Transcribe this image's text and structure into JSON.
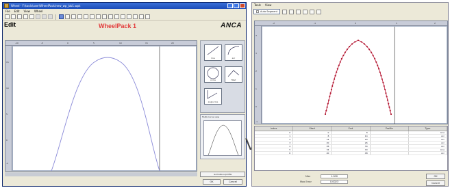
{
  "left_window": {
    "title": "Wheel - F:\\tools\\user\\WheelPack\\new_wp_job1.wpk",
    "menu": [
      "File",
      "Edit",
      "View",
      "Wheel"
    ],
    "edit_label": "Edit",
    "wheel_title": "WheelPack 1",
    "logo": "ANCA",
    "ruler_top_labels": [
      "-10",
      "-5",
      "0",
      "5",
      "10",
      "15",
      "20"
    ],
    "ruler_left_labels": [
      "15",
      "10",
      "5",
      "0",
      "-5"
    ],
    "shapes": [
      {
        "label": "line",
        "icon": "line-shape-icon"
      },
      {
        "label": "arc",
        "icon": "arc-shape-icon"
      },
      {
        "label": "circle",
        "icon": "circle-shape-icon"
      },
      {
        "label": "fillet",
        "icon": "fillet-shape-icon"
      },
      {
        "label": "angle line",
        "icon": "angle-line-shape-icon"
      }
    ],
    "preview_label": "Multi-Curve view",
    "profile_button": "re-locate a profile",
    "ok": "OK",
    "cancel": "Cancel"
  },
  "right_window": {
    "menu": [
      "Tools",
      "View"
    ],
    "auto_segment": "Auto Segment",
    "ruler_top_labels": [
      "-2",
      "-1",
      "0",
      "1",
      "2"
    ],
    "ruler_left_labels": [
      "4",
      "3",
      "2",
      "1",
      "0",
      "-1"
    ],
    "table": {
      "columns": [
        "Index",
        "Start",
        "End",
        "Profile",
        "Type"
      ],
      "rows": [
        [
          "0",
          "0",
          "8",
          "",
          "Line"
        ],
        [
          "1",
          "8",
          "14",
          "",
          "Arc"
        ],
        [
          "2",
          "14",
          "20",
          "",
          "Arc"
        ],
        [
          "3",
          "20",
          "26",
          "",
          "Arc"
        ],
        [
          "4",
          "26",
          "34",
          "",
          "Arc"
        ],
        [
          "5",
          "34",
          "40",
          "",
          "Line"
        ],
        [
          "6",
          "40",
          "48",
          "",
          "Arc"
        ]
      ]
    },
    "stats": {
      "max_label": "Max",
      "max_value": "1.000",
      "error_label": "Max Error",
      "error_value": "0.0023"
    },
    "ok": "OK",
    "cancel": "Cancel"
  },
  "cut_letter": "V"
}
